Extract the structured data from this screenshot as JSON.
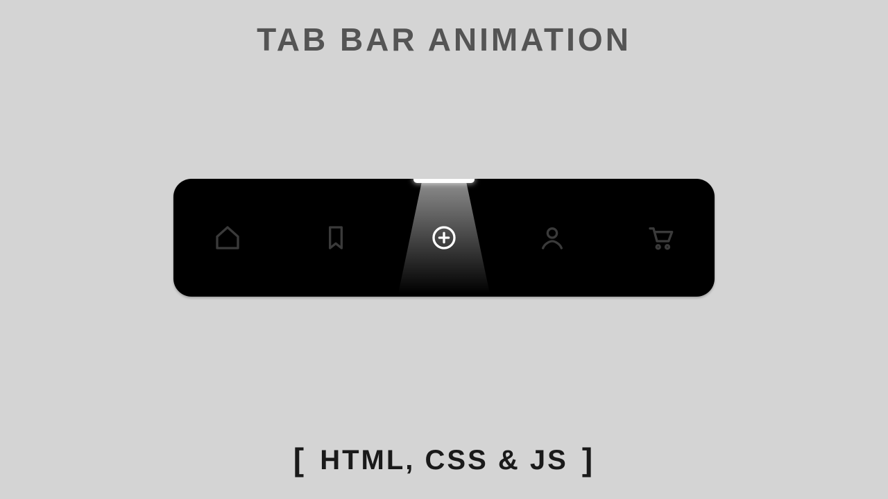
{
  "title": "TAB BAR  ANIMATION",
  "subtitle_inner": "HTML, CSS & JS",
  "colors": {
    "page_bg": "#d4d4d4",
    "title_color": "#545454",
    "subtitle_color": "#1a1a1a",
    "tabbar_bg": "#000000",
    "icon_inactive": "#3a3a3a",
    "icon_active": "#ffffff",
    "indicator": "#ffffff"
  },
  "tabbar": {
    "active_index": 2,
    "items": [
      {
        "icon": "home-icon",
        "label": "Home",
        "active": false
      },
      {
        "icon": "bookmark-icon",
        "label": "Bookmark",
        "active": false
      },
      {
        "icon": "add-icon",
        "label": "Add",
        "active": true
      },
      {
        "icon": "user-icon",
        "label": "Profile",
        "active": false
      },
      {
        "icon": "cart-icon",
        "label": "Cart",
        "active": false
      }
    ]
  }
}
